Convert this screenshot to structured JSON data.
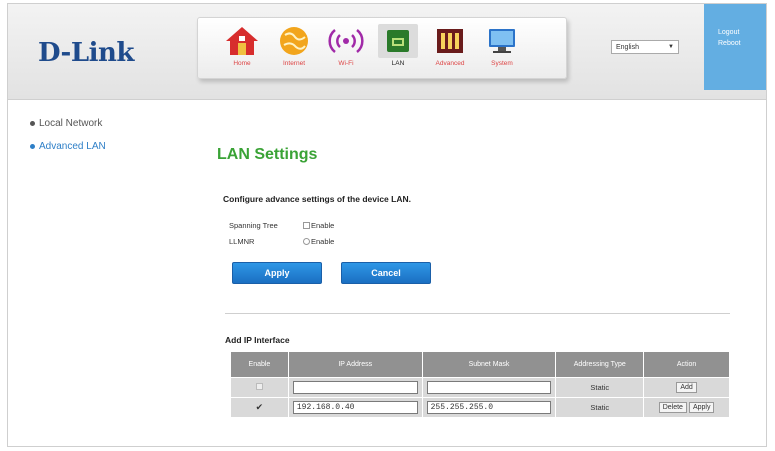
{
  "header": {
    "brand": "D-Link",
    "nav": [
      {
        "label": "Home",
        "icon": "home-icon"
      },
      {
        "label": "Internet",
        "icon": "globe-icon"
      },
      {
        "label": "Wi-Fi",
        "icon": "wifi-icon"
      },
      {
        "label": "LAN",
        "icon": "lan-icon"
      },
      {
        "label": "Advanced",
        "icon": "advanced-icon"
      },
      {
        "label": "System",
        "icon": "system-icon"
      }
    ],
    "language": "English",
    "logout": "Logout",
    "reboot": "Reboot"
  },
  "sidebar": {
    "items": [
      {
        "label": "Local Network"
      },
      {
        "label": "Advanced LAN"
      }
    ]
  },
  "main": {
    "title": "LAN Settings",
    "subtitle": "Configure advance settings of the device LAN.",
    "options": [
      {
        "label": "Spanning Tree",
        "control": "Enable"
      },
      {
        "label": "LLMNR",
        "control": "Enable"
      }
    ],
    "apply": "Apply",
    "cancel": "Cancel",
    "section_title": "Add IP Interface",
    "table": {
      "headers": [
        "Enable",
        "IP Address",
        "Subnet Mask",
        "Addressing Type",
        "Action"
      ],
      "rows": [
        {
          "ip": "",
          "mask": "",
          "type": "Static",
          "actions": [
            "Add"
          ]
        },
        {
          "ip": "192.168.0.40",
          "mask": "255.255.255.0",
          "type": "Static",
          "actions": [
            "Delete",
            "Apply"
          ]
        }
      ]
    }
  },
  "colors": {
    "brand": "#1f4b8c",
    "title_green": "#3aa336",
    "accent_blue": "#2f97e6",
    "table_header": "#919191"
  }
}
